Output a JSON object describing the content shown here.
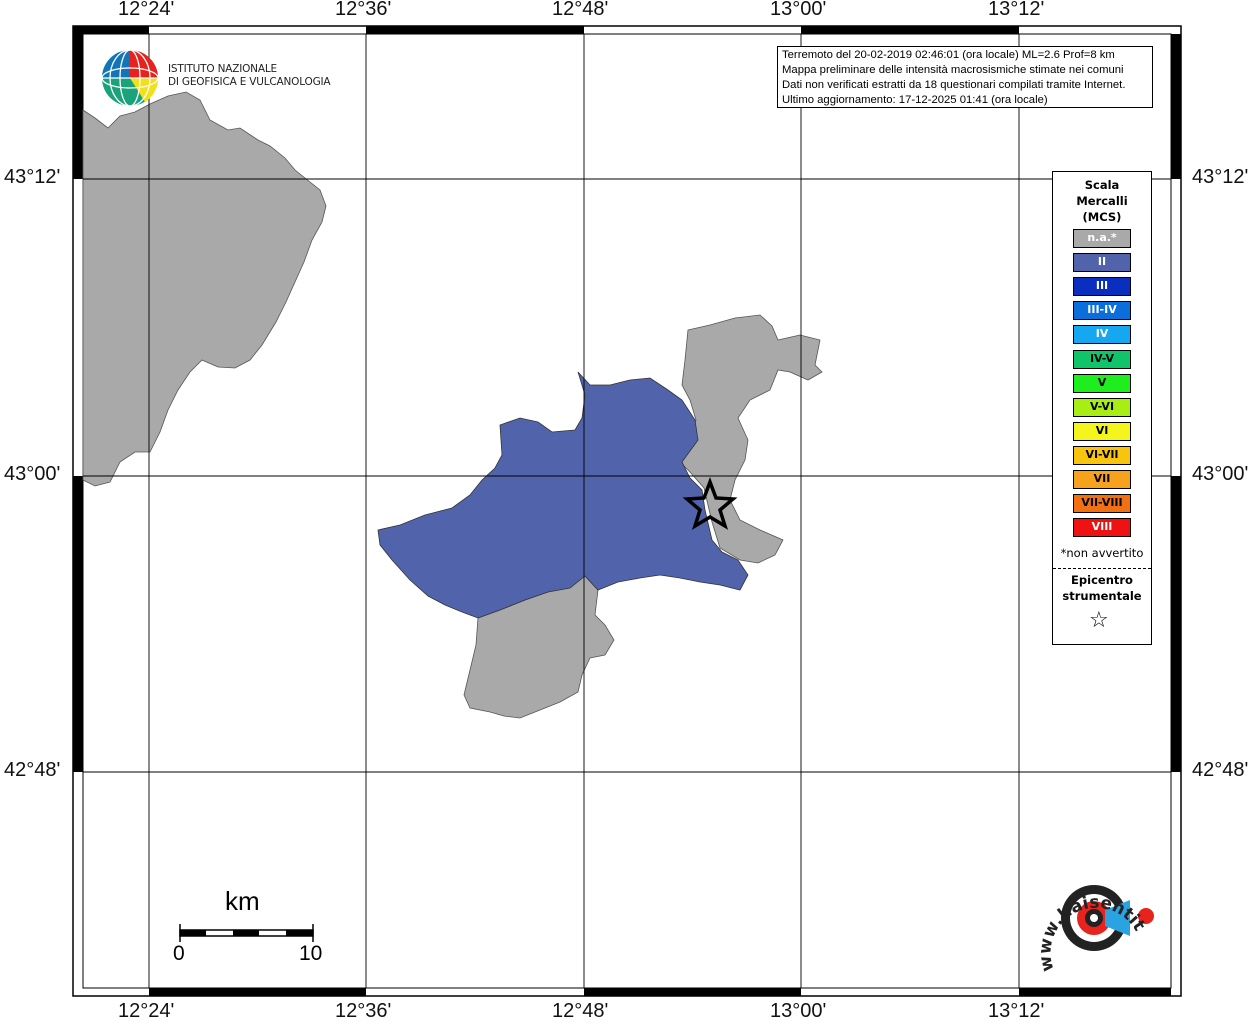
{
  "map": {
    "lon_labels": [
      "12°24'",
      "12°36'",
      "12°48'",
      "13°00'",
      "13°12'"
    ],
    "lat_labels": [
      "43°12'",
      "43°00'",
      "42°48'"
    ]
  },
  "info": {
    "lines": [
      "Terremoto del 20-02-2019 02:46:01 (ora locale) ML=2.6 Prof=8 km",
      "Mappa preliminare delle intensità macrosismiche stimate nei comuni",
      "Dati non verificati estratti da 18 questionari compilati tramite Internet.",
      "Ultimo aggiornamento: 17-12-2025 01:41 (ora locale)"
    ]
  },
  "logo": {
    "line1": "ISTITUTO NAZIONALE",
    "line2": "DI GEOFISICA E VULCANOLOGIA"
  },
  "legend": {
    "title_lines": [
      "Scala",
      "Mercalli",
      "(MCS)"
    ],
    "items": [
      {
        "label": "n.a.*",
        "color": "#a9a9a9",
        "text_color": "#ffffff"
      },
      {
        "label": "II",
        "color": "#5164ab",
        "text_color": "#ffffff"
      },
      {
        "label": "III",
        "color": "#0a2fbe",
        "text_color": "#ffffff"
      },
      {
        "label": "III-IV",
        "color": "#0b6fdb",
        "text_color": "#ffffff"
      },
      {
        "label": "IV",
        "color": "#15a7ef",
        "text_color": "#ffffff"
      },
      {
        "label": "IV-V",
        "color": "#10c46a",
        "text_color": "#000000"
      },
      {
        "label": "V",
        "color": "#1eee1e",
        "text_color": "#000000"
      },
      {
        "label": "V-VI",
        "color": "#a8ee14",
        "text_color": "#000000"
      },
      {
        "label": "VI",
        "color": "#f5f51e",
        "text_color": "#000000"
      },
      {
        "label": "VI-VII",
        "color": "#f8c40d",
        "text_color": "#000000"
      },
      {
        "label": "VII",
        "color": "#f7a21c",
        "text_color": "#000000"
      },
      {
        "label": "VII-VIII",
        "color": "#f27014",
        "text_color": "#000000"
      },
      {
        "label": "VIII",
        "color": "#ee1212",
        "text_color": "#ffffff"
      }
    ],
    "note": "*non avvertito",
    "epicenter_lines": [
      "Epicentro",
      "strumentale"
    ]
  },
  "scalebar": {
    "unit": "km",
    "start": "0",
    "end": "10"
  },
  "haisentito": {
    "text": "www.haisentitoilterremoto.it"
  },
  "colors": {
    "not_felt": "#a9a9a9",
    "intensity_II": "#5164ab"
  }
}
